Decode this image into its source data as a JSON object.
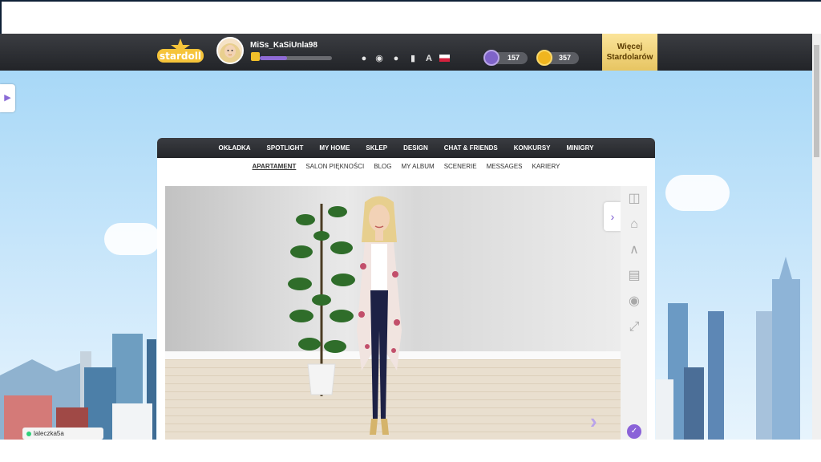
{
  "header": {
    "logo_text": "stardoll",
    "username": "MiSs_KaSiUnla98",
    "level_progress": 0.38,
    "stardollars": "157",
    "coins": "357",
    "more_button": "Więcej Stardolarów",
    "icons": [
      "bell-icon",
      "chat-icon",
      "friends-icon",
      "bookmark-icon",
      "text-icon",
      "flag-icon"
    ]
  },
  "main_nav": [
    "OKŁADKA",
    "SPOTLIGHT",
    "MY HOME",
    "SKLEP",
    "DESIGN",
    "CHAT & FRIENDS",
    "KONKURSY",
    "MINIGRY"
  ],
  "sub_nav": [
    "APARTAMENT",
    "SALON PIĘKNOŚCI",
    "BLOG",
    "MY ALBUM",
    "SCENERIE",
    "MESSAGES",
    "KARIERY"
  ],
  "online_user": "laleczka5a",
  "colors": {
    "accent": "#8a62d8",
    "header_dark": "#24262a",
    "gold": "#e7c562"
  }
}
